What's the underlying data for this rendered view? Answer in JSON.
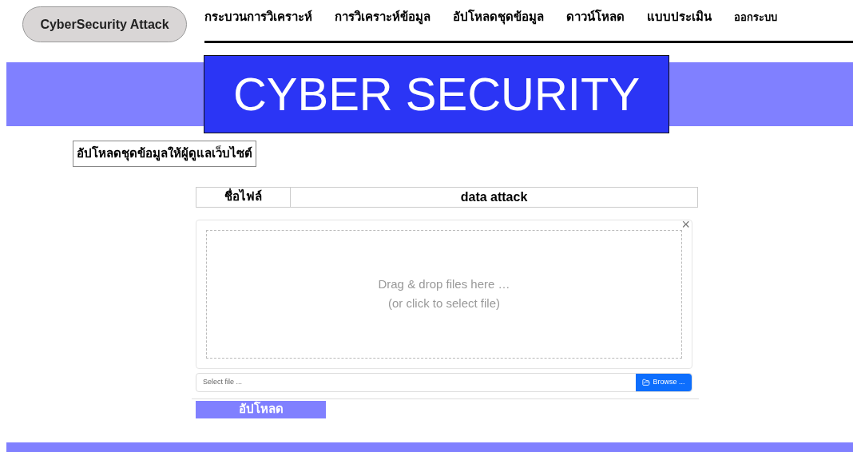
{
  "brand": "CyberSecurity Attack",
  "nav": [
    "กระบวนการวิเคราะห์",
    "การวิเคราะห์ข้อมูล",
    "อัปโหลดชุดข้อมูล",
    "ดาวน์โหลด",
    "แบบประเมิน",
    "ออกระบบ"
  ],
  "banner": {
    "title": "CYBER SECURITY"
  },
  "section_title": "อัปโหลดชุดข้อมูลให้ผู้ดูแลเว็บไซต์",
  "file_table": {
    "label": "ชื่อไฟล์",
    "value": "data attack"
  },
  "dropzone": {
    "line1": "Drag & drop files here …",
    "line2": "(or click to select file)",
    "close": "×"
  },
  "file_input": {
    "placeholder": "Select file ...",
    "browse": "Browse ..."
  },
  "upload_button": "อัปโหลด"
}
